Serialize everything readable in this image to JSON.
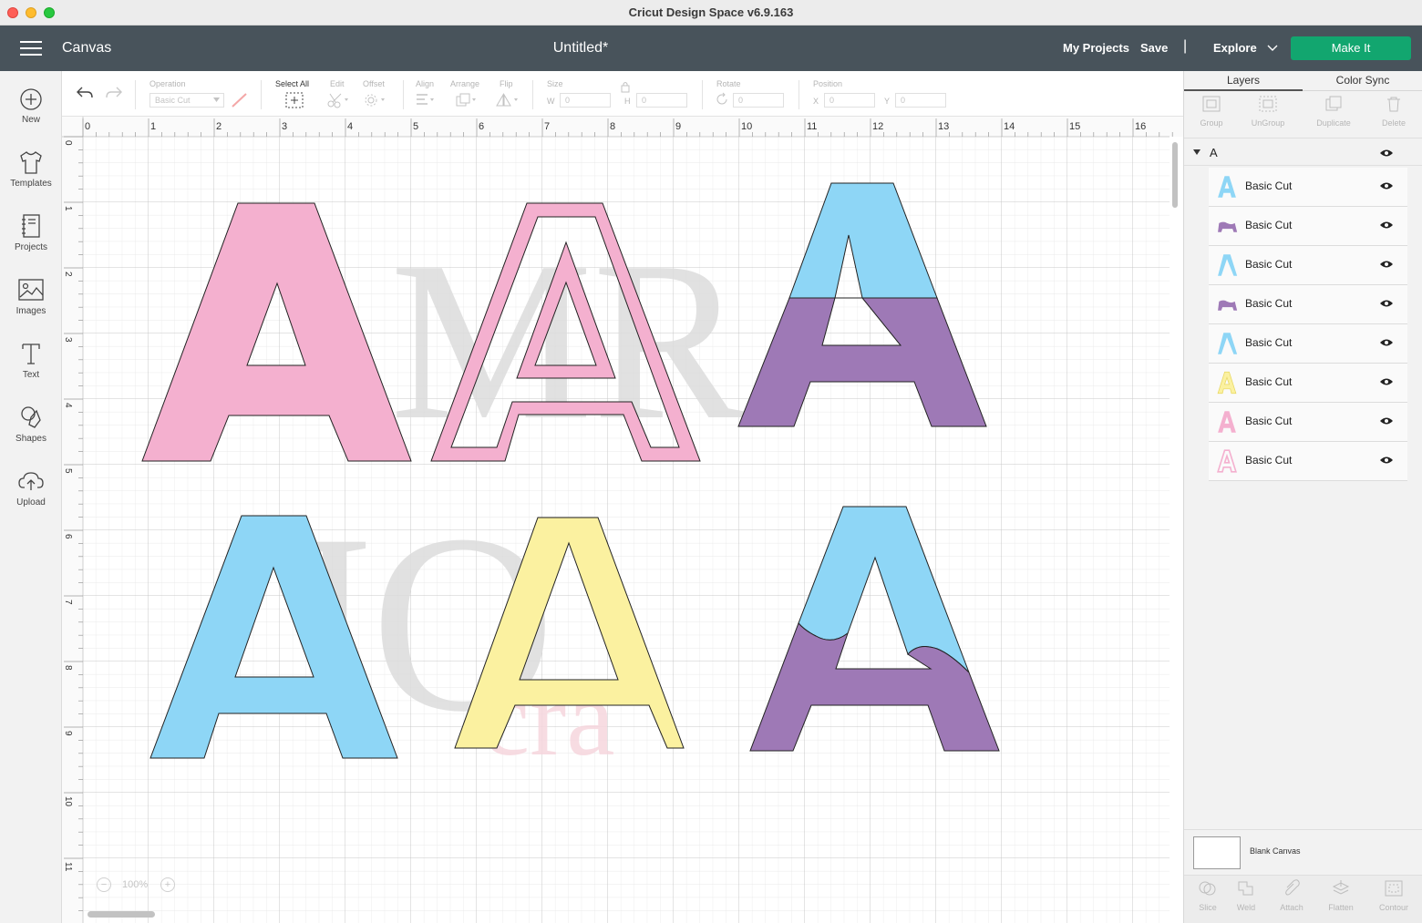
{
  "window": {
    "title": "Cricut Design Space  v6.9.163"
  },
  "header": {
    "section": "Canvas",
    "document": "Untitled*",
    "my_projects": "My Projects",
    "save": "Save",
    "separator": "|",
    "explore": "Explore",
    "make_it": "Make It",
    "accent_color": "#12a66f",
    "bar_color": "#48535b"
  },
  "left_tools": [
    {
      "label": "New",
      "icon": "plus-circle-icon"
    },
    {
      "label": "Templates",
      "icon": "tshirt-icon"
    },
    {
      "label": "Projects",
      "icon": "notebook-icon"
    },
    {
      "label": "Images",
      "icon": "image-icon"
    },
    {
      "label": "Text",
      "icon": "text-icon"
    },
    {
      "label": "Shapes",
      "icon": "shapes-icon"
    },
    {
      "label": "Upload",
      "icon": "cloud-upload-icon"
    }
  ],
  "toolbar": {
    "operation_label": "Operation",
    "operation_value": "Basic Cut",
    "select_all": "Select All",
    "edit": "Edit",
    "offset": "Offset",
    "align": "Align",
    "arrange": "Arrange",
    "flip": "Flip",
    "size": "Size",
    "w_label": "W",
    "w_value": "0",
    "h_label": "H",
    "h_value": "0",
    "rotate": "Rotate",
    "rotate_value": "0",
    "position": "Position",
    "x_label": "X",
    "x_value": "0",
    "y_label": "Y",
    "y_value": "0"
  },
  "canvas": {
    "ruler_top": [
      "0",
      "1",
      "2",
      "3",
      "4",
      "5",
      "6",
      "7",
      "8",
      "9",
      "10",
      "11",
      "12",
      "13",
      "14",
      "15",
      "16"
    ],
    "ruler_left": [
      "0",
      "1",
      "2",
      "3",
      "4",
      "5",
      "6",
      "7",
      "8",
      "9",
      "10",
      "11"
    ],
    "zoom": "100%",
    "zoom_out": "−",
    "zoom_in": "+",
    "watermark": {
      "line1": "MR",
      "line2": "JO",
      "line3": "cra"
    },
    "letter": "A",
    "colors": {
      "pink": "#f4b0cf",
      "blue": "#8ed6f6",
      "purple": "#9e79b6",
      "yellow": "#fbf1a0"
    }
  },
  "right_panel": {
    "tab_layers": "Layers",
    "tab_color_sync": "Color Sync",
    "actions": [
      "Group",
      "UnGroup",
      "Duplicate",
      "Delete"
    ],
    "group_name": "A",
    "layers": [
      {
        "name": "Basic Cut",
        "thumb": "blue-A"
      },
      {
        "name": "Basic Cut",
        "thumb": "purple-band"
      },
      {
        "name": "Basic Cut",
        "thumb": "blue-A-top"
      },
      {
        "name": "Basic Cut",
        "thumb": "purple-band"
      },
      {
        "name": "Basic Cut",
        "thumb": "blue-A-top"
      },
      {
        "name": "Basic Cut",
        "thumb": "yellow-A"
      },
      {
        "name": "Basic Cut",
        "thumb": "pink-A"
      },
      {
        "name": "Basic Cut",
        "thumb": "pink-outline-A"
      }
    ],
    "blank_canvas": "Blank Canvas",
    "bottom_actions": [
      "Slice",
      "Weld",
      "Attach",
      "Flatten",
      "Contour"
    ]
  }
}
